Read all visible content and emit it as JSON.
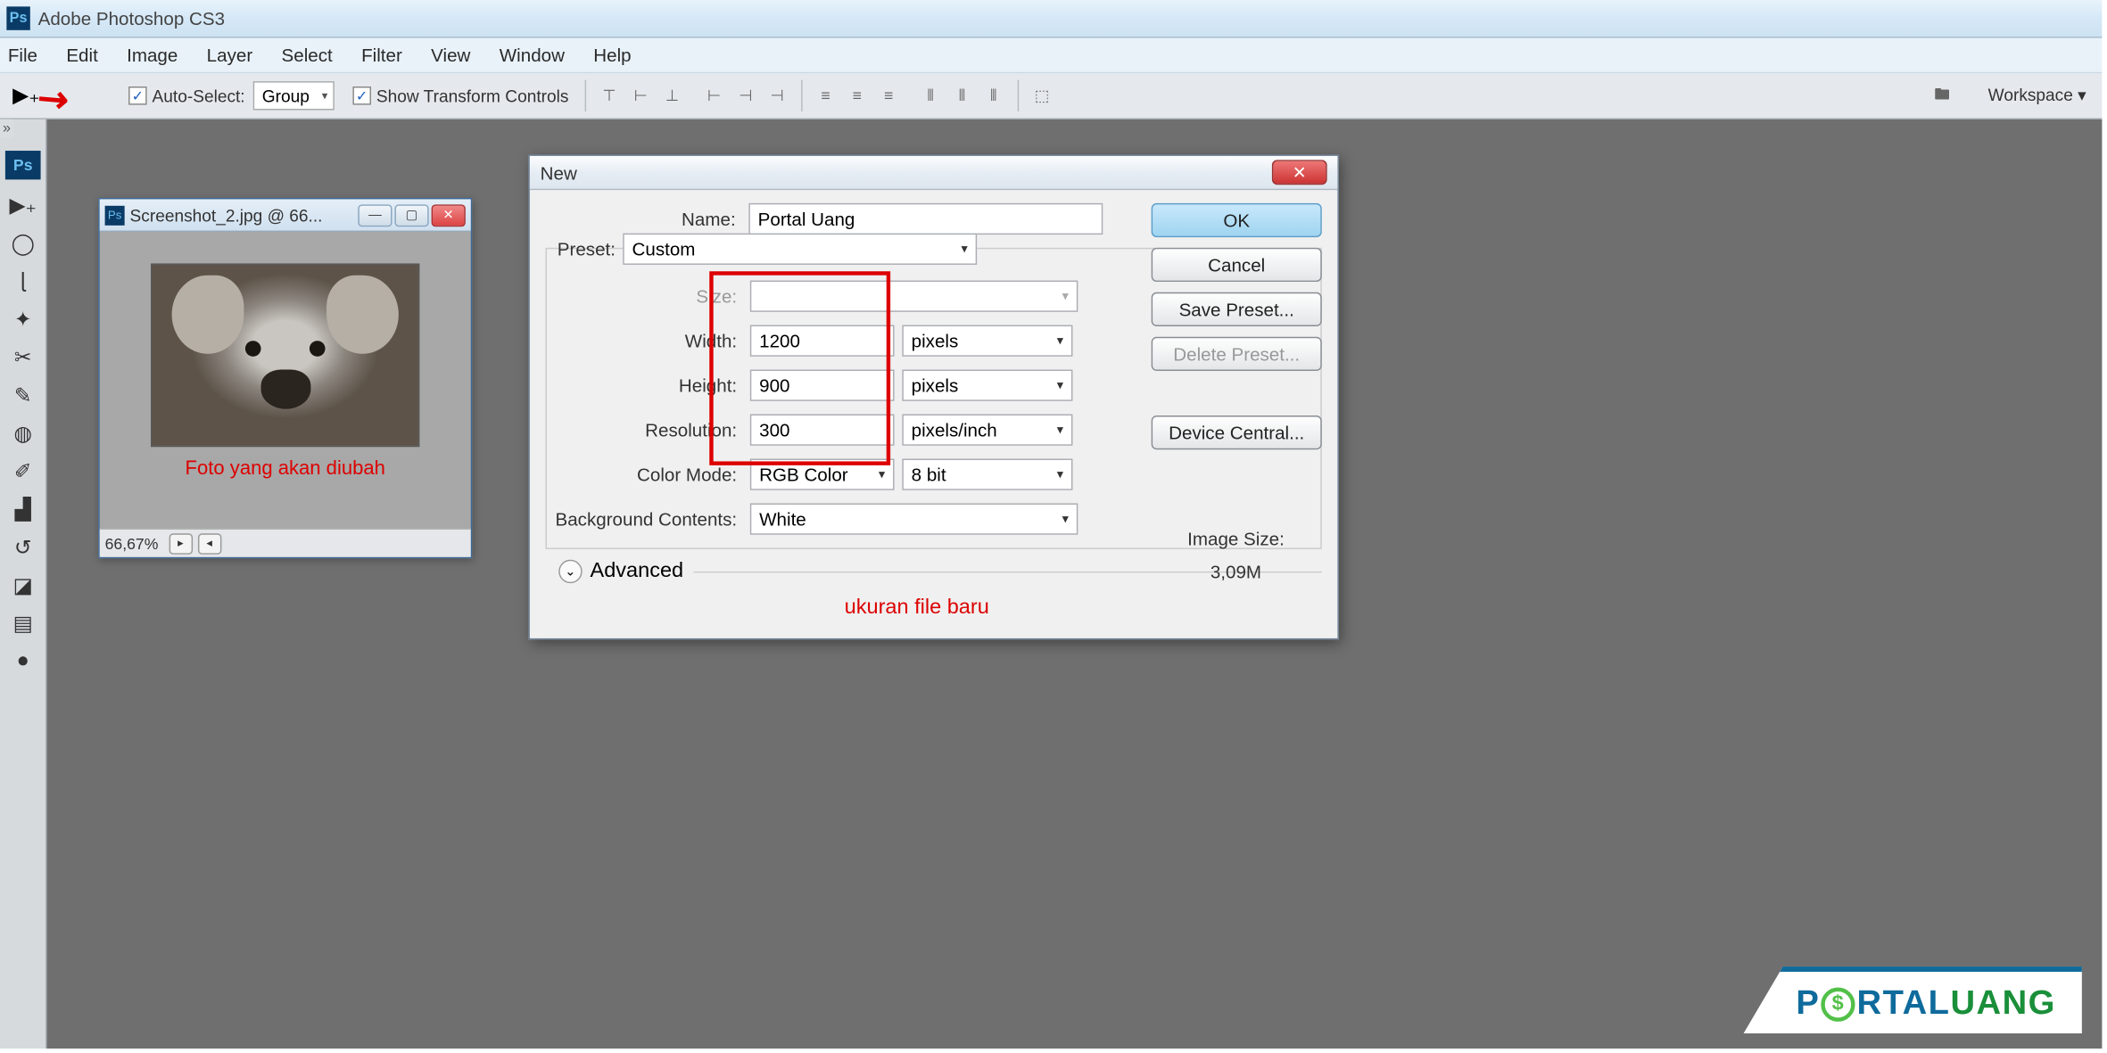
{
  "app_title": "Adobe Photoshop CS3",
  "menubar": [
    "File",
    "Edit",
    "Image",
    "Layer",
    "Select",
    "Filter",
    "View",
    "Window",
    "Help"
  ],
  "optbar": {
    "auto_select": "Auto-Select:",
    "group": "Group",
    "show_transform": "Show Transform Controls",
    "workspace": "Workspace ▾"
  },
  "doc": {
    "title": "Screenshot_2.jpg @ 66...",
    "zoom": "66,67%",
    "annotation": "Foto yang akan diubah"
  },
  "dialog": {
    "title": "New",
    "name_label": "Name:",
    "name_value": "Portal Uang",
    "preset_label": "Preset:",
    "preset_value": "Custom",
    "size_label": "Size:",
    "width_label": "Width:",
    "width_value": "1200",
    "width_unit": "pixels",
    "height_label": "Height:",
    "height_value": "900",
    "height_unit": "pixels",
    "resolution_label": "Resolution:",
    "resolution_value": "300",
    "resolution_unit": "pixels/inch",
    "colormode_label": "Color Mode:",
    "colormode_value": "RGB Color",
    "colormode_depth": "8 bit",
    "bg_label": "Background Contents:",
    "bg_value": "White",
    "advanced": "Advanced",
    "image_size_label": "Image Size:",
    "image_size_value": "3,09M",
    "annotation": "ukuran file baru",
    "buttons": {
      "ok": "OK",
      "cancel": "Cancel",
      "save_preset": "Save Preset...",
      "delete_preset": "Delete Preset...",
      "device_central": "Device Central..."
    }
  },
  "watermark": {
    "p": "P",
    "dollar": "$",
    "rtal": "RTAL",
    "uang": "UANG"
  }
}
